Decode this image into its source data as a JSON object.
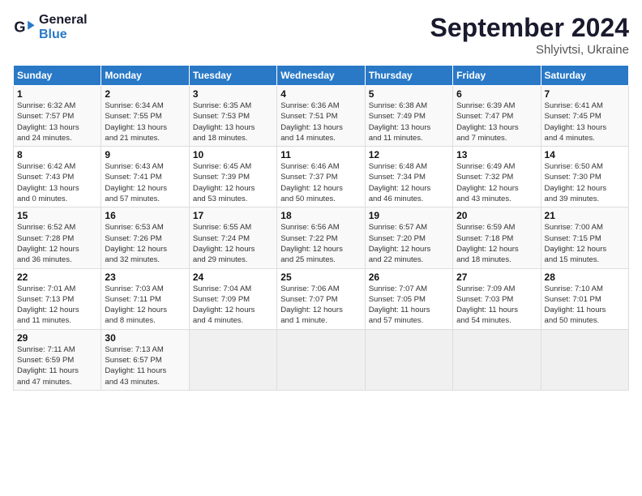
{
  "header": {
    "logo_line1": "General",
    "logo_line2": "Blue",
    "month": "September 2024",
    "location": "Shlyivtsi, Ukraine"
  },
  "weekdays": [
    "Sunday",
    "Monday",
    "Tuesday",
    "Wednesday",
    "Thursday",
    "Friday",
    "Saturday"
  ],
  "weeks": [
    [
      {
        "day": "1",
        "info": "Sunrise: 6:32 AM\nSunset: 7:57 PM\nDaylight: 13 hours\nand 24 minutes."
      },
      {
        "day": "2",
        "info": "Sunrise: 6:34 AM\nSunset: 7:55 PM\nDaylight: 13 hours\nand 21 minutes."
      },
      {
        "day": "3",
        "info": "Sunrise: 6:35 AM\nSunset: 7:53 PM\nDaylight: 13 hours\nand 18 minutes."
      },
      {
        "day": "4",
        "info": "Sunrise: 6:36 AM\nSunset: 7:51 PM\nDaylight: 13 hours\nand 14 minutes."
      },
      {
        "day": "5",
        "info": "Sunrise: 6:38 AM\nSunset: 7:49 PM\nDaylight: 13 hours\nand 11 minutes."
      },
      {
        "day": "6",
        "info": "Sunrise: 6:39 AM\nSunset: 7:47 PM\nDaylight: 13 hours\nand 7 minutes."
      },
      {
        "day": "7",
        "info": "Sunrise: 6:41 AM\nSunset: 7:45 PM\nDaylight: 13 hours\nand 4 minutes."
      }
    ],
    [
      {
        "day": "8",
        "info": "Sunrise: 6:42 AM\nSunset: 7:43 PM\nDaylight: 13 hours\nand 0 minutes."
      },
      {
        "day": "9",
        "info": "Sunrise: 6:43 AM\nSunset: 7:41 PM\nDaylight: 12 hours\nand 57 minutes."
      },
      {
        "day": "10",
        "info": "Sunrise: 6:45 AM\nSunset: 7:39 PM\nDaylight: 12 hours\nand 53 minutes."
      },
      {
        "day": "11",
        "info": "Sunrise: 6:46 AM\nSunset: 7:37 PM\nDaylight: 12 hours\nand 50 minutes."
      },
      {
        "day": "12",
        "info": "Sunrise: 6:48 AM\nSunset: 7:34 PM\nDaylight: 12 hours\nand 46 minutes."
      },
      {
        "day": "13",
        "info": "Sunrise: 6:49 AM\nSunset: 7:32 PM\nDaylight: 12 hours\nand 43 minutes."
      },
      {
        "day": "14",
        "info": "Sunrise: 6:50 AM\nSunset: 7:30 PM\nDaylight: 12 hours\nand 39 minutes."
      }
    ],
    [
      {
        "day": "15",
        "info": "Sunrise: 6:52 AM\nSunset: 7:28 PM\nDaylight: 12 hours\nand 36 minutes."
      },
      {
        "day": "16",
        "info": "Sunrise: 6:53 AM\nSunset: 7:26 PM\nDaylight: 12 hours\nand 32 minutes."
      },
      {
        "day": "17",
        "info": "Sunrise: 6:55 AM\nSunset: 7:24 PM\nDaylight: 12 hours\nand 29 minutes."
      },
      {
        "day": "18",
        "info": "Sunrise: 6:56 AM\nSunset: 7:22 PM\nDaylight: 12 hours\nand 25 minutes."
      },
      {
        "day": "19",
        "info": "Sunrise: 6:57 AM\nSunset: 7:20 PM\nDaylight: 12 hours\nand 22 minutes."
      },
      {
        "day": "20",
        "info": "Sunrise: 6:59 AM\nSunset: 7:18 PM\nDaylight: 12 hours\nand 18 minutes."
      },
      {
        "day": "21",
        "info": "Sunrise: 7:00 AM\nSunset: 7:15 PM\nDaylight: 12 hours\nand 15 minutes."
      }
    ],
    [
      {
        "day": "22",
        "info": "Sunrise: 7:01 AM\nSunset: 7:13 PM\nDaylight: 12 hours\nand 11 minutes."
      },
      {
        "day": "23",
        "info": "Sunrise: 7:03 AM\nSunset: 7:11 PM\nDaylight: 12 hours\nand 8 minutes."
      },
      {
        "day": "24",
        "info": "Sunrise: 7:04 AM\nSunset: 7:09 PM\nDaylight: 12 hours\nand 4 minutes."
      },
      {
        "day": "25",
        "info": "Sunrise: 7:06 AM\nSunset: 7:07 PM\nDaylight: 12 hours\nand 1 minute."
      },
      {
        "day": "26",
        "info": "Sunrise: 7:07 AM\nSunset: 7:05 PM\nDaylight: 11 hours\nand 57 minutes."
      },
      {
        "day": "27",
        "info": "Sunrise: 7:09 AM\nSunset: 7:03 PM\nDaylight: 11 hours\nand 54 minutes."
      },
      {
        "day": "28",
        "info": "Sunrise: 7:10 AM\nSunset: 7:01 PM\nDaylight: 11 hours\nand 50 minutes."
      }
    ],
    [
      {
        "day": "29",
        "info": "Sunrise: 7:11 AM\nSunset: 6:59 PM\nDaylight: 11 hours\nand 47 minutes."
      },
      {
        "day": "30",
        "info": "Sunrise: 7:13 AM\nSunset: 6:57 PM\nDaylight: 11 hours\nand 43 minutes."
      },
      {
        "day": "",
        "info": ""
      },
      {
        "day": "",
        "info": ""
      },
      {
        "day": "",
        "info": ""
      },
      {
        "day": "",
        "info": ""
      },
      {
        "day": "",
        "info": ""
      }
    ]
  ]
}
